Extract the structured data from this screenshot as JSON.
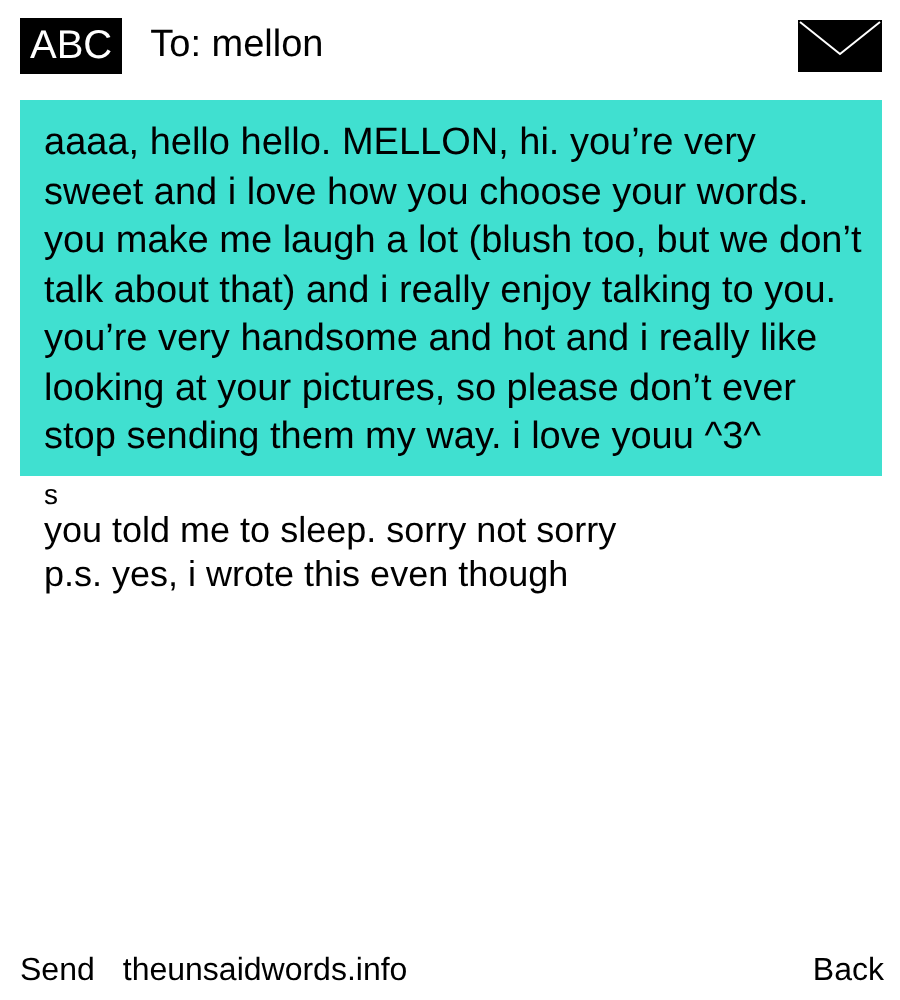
{
  "header": {
    "input_mode": "ABC",
    "recipient": "To: mellon"
  },
  "message": {
    "body": "aaaa, hello hello. MELLON, hi. you’re very sweet and i love how you choose your words. you make me laugh a lot (blush too, but we don’t talk about that) and i really enjoy talking to you. you’re very handsome and hot and i really like looking at your pictures, so please don’t ever stop sending them my way. i love youu ^3^",
    "overflow": [
      "s",
      "you told me to sleep. sorry not sorry",
      "p.s. yes, i wrote this even though"
    ]
  },
  "softkeys": {
    "left": "Send",
    "center": "theunsaidwords.info",
    "right": "Back"
  }
}
